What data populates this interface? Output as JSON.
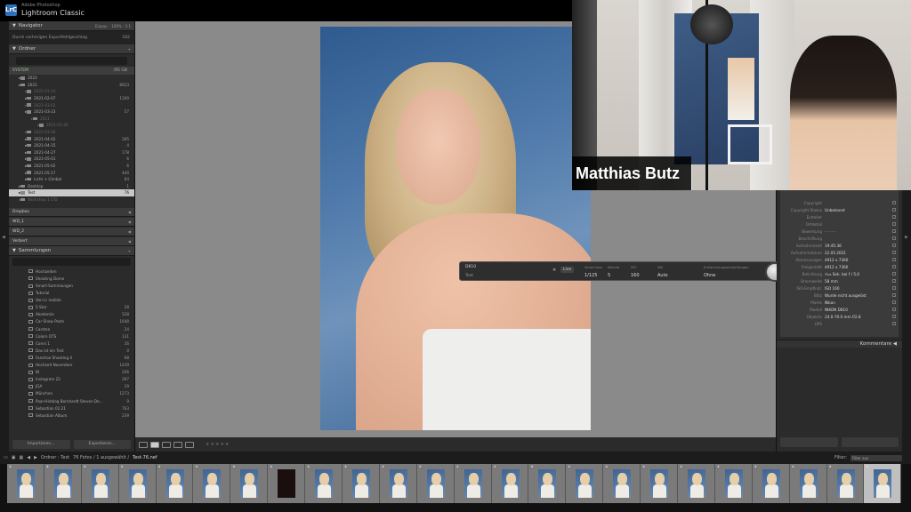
{
  "app": {
    "vendor": "Adobe Photoshop",
    "name": "Lightroom Classic",
    "logo": "LrC"
  },
  "navigator": {
    "title": "Navigator",
    "zoom_options": [
      "Einpas.",
      "100%",
      "1:1"
    ],
    "status": "Durch vorherigen Exportfehlgeschlag",
    "status_count": "162"
  },
  "folders": {
    "title": "Ordner",
    "volume": {
      "name": "SYSTEM",
      "size": "/95 GB"
    },
    "rows": [
      {
        "label": "2022",
        "count": "",
        "indent": 1,
        "sel": false,
        "dim": false
      },
      {
        "label": "2021",
        "count": "8923",
        "indent": 1,
        "sel": false,
        "dim": false
      },
      {
        "label": "2021-01-14",
        "count": "",
        "indent": 2,
        "sel": false,
        "dim": true
      },
      {
        "label": "2021-02-07",
        "count": "1100",
        "indent": 2,
        "sel": false,
        "dim": false
      },
      {
        "label": "2021-03-02",
        "count": "",
        "indent": 2,
        "sel": false,
        "dim": true
      },
      {
        "label": "2021-03-23",
        "count": "57",
        "indent": 2,
        "sel": false,
        "dim": false
      },
      {
        "label": "2021",
        "count": "",
        "indent": 3,
        "sel": false,
        "dim": true
      },
      {
        "label": "2021-03-30",
        "count": "",
        "indent": 4,
        "sel": false,
        "dim": true
      },
      {
        "label": "2021-03-26",
        "count": "",
        "indent": 2,
        "sel": false,
        "dim": true
      },
      {
        "label": "2021-04-02",
        "count": "285",
        "indent": 2,
        "sel": false,
        "dim": false
      },
      {
        "label": "2021-04-15",
        "count": "4",
        "indent": 2,
        "sel": false,
        "dim": false
      },
      {
        "label": "2021-04-27",
        "count": "178",
        "indent": 2,
        "sel": false,
        "dim": false
      },
      {
        "label": "2021-05-01",
        "count": "6",
        "indent": 2,
        "sel": false,
        "dim": false
      },
      {
        "label": "2021-05-02",
        "count": "6",
        "indent": 2,
        "sel": false,
        "dim": false
      },
      {
        "label": "2021-05-17",
        "count": "440",
        "indent": 2,
        "sel": false,
        "dim": false
      },
      {
        "label": "Licht + Gimbal",
        "count": "84",
        "indent": 2,
        "sel": false,
        "dim": false
      },
      {
        "label": "Desktop",
        "count": "1",
        "indent": 1,
        "sel": false,
        "dim": false
      },
      {
        "label": "Test",
        "count": "76",
        "indent": 1,
        "sel": true,
        "dim": false
      },
      {
        "label": "Workshop 1 LTD",
        "count": "",
        "indent": 1,
        "sel": false,
        "dim": true
      }
    ],
    "collapsed": [
      "Dropbox",
      "WD_1",
      "WD_2",
      "Verbert"
    ]
  },
  "collections": {
    "title": "Sammlungen",
    "items": [
      {
        "label": "Hochzeiten",
        "count": ""
      },
      {
        "label": "Shooting Dome",
        "count": ""
      },
      {
        "label": "Smart-Sammlungen",
        "count": ""
      },
      {
        "label": "Tutorial",
        "count": ""
      },
      {
        "label": "Von Lr mobile",
        "count": ""
      },
      {
        "label": "5 Star",
        "count": "28"
      },
      {
        "label": "Akademie",
        "count": "528"
      },
      {
        "label": "Car Show Posts",
        "count": "1648"
      },
      {
        "label": "Carsten",
        "count": "24"
      },
      {
        "label": "Colorn DTS",
        "count": "131"
      },
      {
        "label": "Conni 1",
        "count": "16"
      },
      {
        "label": "Das ist ein Test",
        "count": "0"
      },
      {
        "label": "Fanshoe Shooting 4",
        "count": "68"
      },
      {
        "label": "Hochzeit November",
        "count": "1439"
      },
      {
        "label": "IB",
        "count": "206"
      },
      {
        "label": "Instagram 22",
        "count": "287"
      },
      {
        "label": "JGA",
        "count": "19"
      },
      {
        "label": "München",
        "count": "1273"
      },
      {
        "label": "Paar-Hinblog Bornhardt Steven De...",
        "count": "9"
      },
      {
        "label": "Sebastian 02.21",
        "count": "763"
      },
      {
        "label": "Sebastian Album",
        "count": "239"
      }
    ],
    "import_label": "Importieren...",
    "export_label": "Exportieren..."
  },
  "tether": {
    "camera": "D810",
    "session": "Test",
    "live_label": "Live",
    "fields": [
      {
        "label": "Verschluss",
        "value": "1/125"
      },
      {
        "label": "Blende",
        "value": "5"
      },
      {
        "label": "ISO",
        "value": "160"
      },
      {
        "label": "WA",
        "value": "Auto"
      },
      {
        "label": "Entwicklungseinstellungen",
        "value": "Ohne"
      }
    ]
  },
  "webcam": {
    "name": "Matthias Butz"
  },
  "metadata": {
    "rows": [
      {
        "k": "Copyright",
        "v": ""
      },
      {
        "k": "Copyright-Status",
        "v": "Unbekannt"
      },
      {
        "k": "Ersteller",
        "v": ""
      },
      {
        "k": "Ortdetail",
        "v": ""
      },
      {
        "k": "Bewertung",
        "v": "· · · · ·"
      },
      {
        "k": "Beschriftung",
        "v": ""
      },
      {
        "k": "Aufnahmezeit",
        "v": "19:45:36"
      },
      {
        "k": "Aufnahmedatum",
        "v": "22.05.2021"
      },
      {
        "k": "Abmessungen",
        "v": "4912 x 7360"
      },
      {
        "k": "Freigestellt",
        "v": "4912 x 7360"
      },
      {
        "k": "Belichtung",
        "v": "¹⁄₁₂₅ Sek. bei f / 5,0"
      },
      {
        "k": "Brennweite",
        "v": "58 mm"
      },
      {
        "k": "ISO-Empfindl.",
        "v": "ISO 160"
      },
      {
        "k": "Blitz",
        "v": "Wurde nicht ausgelöst"
      },
      {
        "k": "Marke",
        "v": "Nikon"
      },
      {
        "k": "Modell",
        "v": "NIKON D810"
      },
      {
        "k": "Objektiv",
        "v": "24.0-70.0 mm f/2.8"
      },
      {
        "k": "GPS",
        "v": ""
      }
    ],
    "comments_label": "Kommentare"
  },
  "filmstrip": {
    "source": "Ordner : Test",
    "count_text": "76 Fotos / 1 ausgewählt /",
    "file": "Test-76.nef",
    "filter_label": "Filter:",
    "filter_value": "Filter aus",
    "thumbs": 24,
    "dark_index": 7,
    "selected_index": 23
  },
  "colors": {
    "accent": "#2f6fb5",
    "panel": "#2b2b2b",
    "selected_row": "#c9c9c9"
  }
}
